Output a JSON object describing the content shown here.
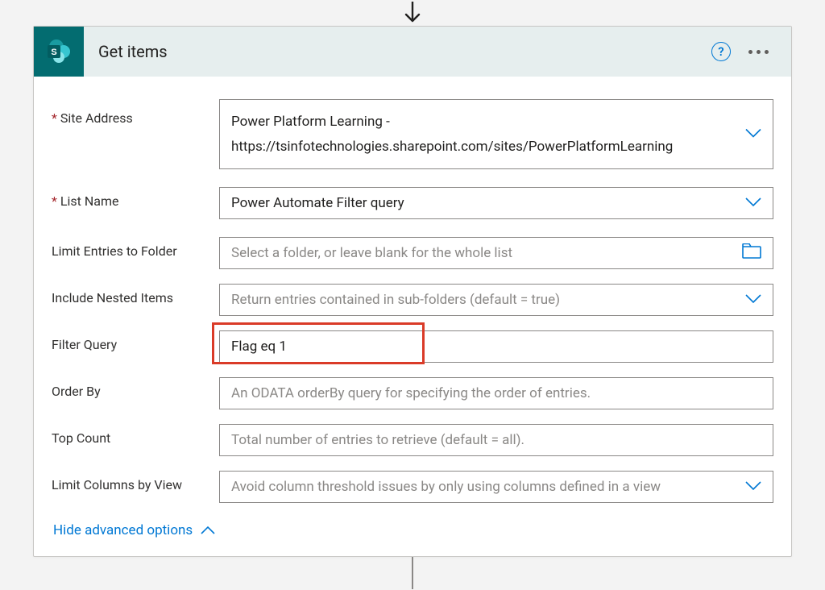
{
  "action": {
    "title": "Get items",
    "help_glyph": "?"
  },
  "fields": {
    "site_address": {
      "label": "Site Address",
      "line1": "Power Platform Learning -",
      "line2": "https://tsinfotechnologies.sharepoint.com/sites/PowerPlatformLearning"
    },
    "list_name": {
      "label": "List Name",
      "value": "Power Automate Filter query"
    },
    "limit_folder": {
      "label": "Limit Entries to Folder",
      "placeholder": "Select a folder, or leave blank for the whole list"
    },
    "include_nested": {
      "label": "Include Nested Items",
      "placeholder": "Return entries contained in sub-folders (default = true)"
    },
    "filter_query": {
      "label": "Filter Query",
      "value": "Flag eq 1"
    },
    "order_by": {
      "label": "Order By",
      "placeholder": "An ODATA orderBy query for specifying the order of entries."
    },
    "top_count": {
      "label": "Top Count",
      "placeholder": "Total number of entries to retrieve (default = all)."
    },
    "limit_columns": {
      "label": "Limit Columns by View",
      "placeholder": "Avoid column threshold issues by only using columns defined in a view"
    }
  },
  "advanced_toggle": "Hide advanced options"
}
